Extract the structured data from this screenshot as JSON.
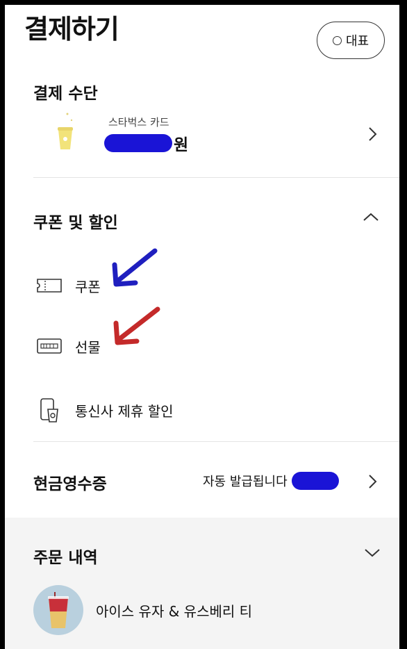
{
  "header": {
    "title": "결제하기",
    "representative_button_label": "대표"
  },
  "payment_method": {
    "section_title": "결제 수단",
    "card_type_label": "스타벅스 카드",
    "amount_suffix": "원"
  },
  "coupons_discounts": {
    "section_title": "쿠폰 및 할인",
    "items": [
      {
        "label": "쿠폰",
        "icon": "coupon-ticket-icon"
      },
      {
        "label": "선물",
        "icon": "gift-card-icon"
      },
      {
        "label": "통신사 제휴 할인",
        "icon": "phone-cup-icon"
      }
    ]
  },
  "cash_receipt": {
    "section_title": "현금영수증",
    "status_text": "자동 발급됩니다"
  },
  "order_history": {
    "section_title": "주문 내역",
    "items": [
      {
        "name": "아이스 유자 & 유스베리 티"
      }
    ]
  },
  "colors": {
    "redaction": "#1a14d6",
    "annotation_blue": "#1f1fbf",
    "annotation_red": "#c42a2a",
    "gray_band": "#f4f4f4"
  }
}
